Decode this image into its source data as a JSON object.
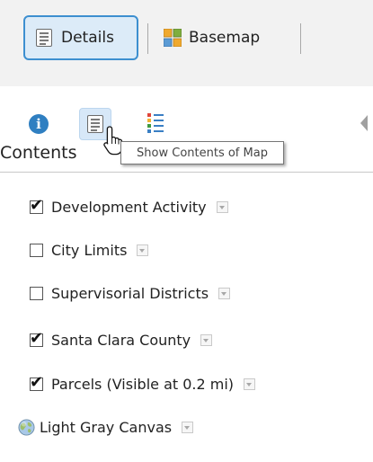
{
  "toolbar": {
    "details_label": "Details",
    "basemap_label": "Basemap"
  },
  "tabs": {
    "info_glyph": "i",
    "about_icon": "info-icon",
    "content_icon": "document-list-icon",
    "legend_icon": "legend-list-icon"
  },
  "tooltip": "Show Contents of Map",
  "contents_heading": "Contents",
  "layers": [
    {
      "label": "Development Activity",
      "checked": true
    },
    {
      "label": "City Limits",
      "checked": false
    },
    {
      "label": "Supervisorial Districts",
      "checked": false
    },
    {
      "label": "Santa Clara County",
      "checked": true
    },
    {
      "label": "Parcels (Visible at 0.2 mi)",
      "checked": true
    }
  ],
  "basemap_layer": {
    "label": "Light Gray Canvas",
    "icon": "globe-icon"
  },
  "check_glyph": "✔",
  "colors": {
    "accent_blue": "#3d8fd0",
    "active_fill": "#dcebf8",
    "toolbar_bg": "#f2f2f2",
    "info_blue": "#2f7fc1"
  }
}
